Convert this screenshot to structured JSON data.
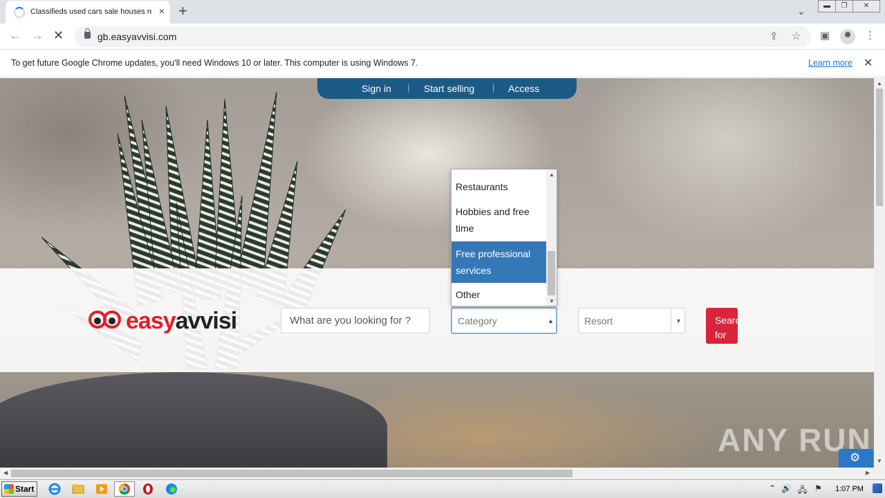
{
  "browser": {
    "tab_title": "Classifieds used cars sale houses rent",
    "url": "gb.easyavvisi.com",
    "new_tab": "+",
    "tab_close": "×"
  },
  "infobar": {
    "message": "To get future Google Chrome updates, you'll need Windows 10 or later. This computer is using Windows 7.",
    "link": "Learn more"
  },
  "site": {
    "nav": [
      "Sign in",
      "Start selling",
      "Access"
    ],
    "logo": {
      "red": "easy",
      "dark": "avvisi"
    },
    "search_placeholder": "What are you looking for ?",
    "category_placeholder": "Category",
    "resort_placeholder": "Resort",
    "search_button": "Search for"
  },
  "category_dropdown": {
    "items": [
      {
        "label": "Restaurants",
        "selected": false
      },
      {
        "label": "Hobbies and free time",
        "selected": false
      },
      {
        "label": "Free professional services",
        "selected": true
      },
      {
        "label": "Other",
        "selected": false
      }
    ],
    "highlight_color": "#3478b8"
  },
  "watermark": "ANY RUN",
  "taskbar": {
    "start_label": "Start",
    "clock": "1:07 PM"
  },
  "colors": {
    "nav_bg": "#1b5a85",
    "brand_red": "#e31e24",
    "search_button_bg": "#d9243a"
  }
}
